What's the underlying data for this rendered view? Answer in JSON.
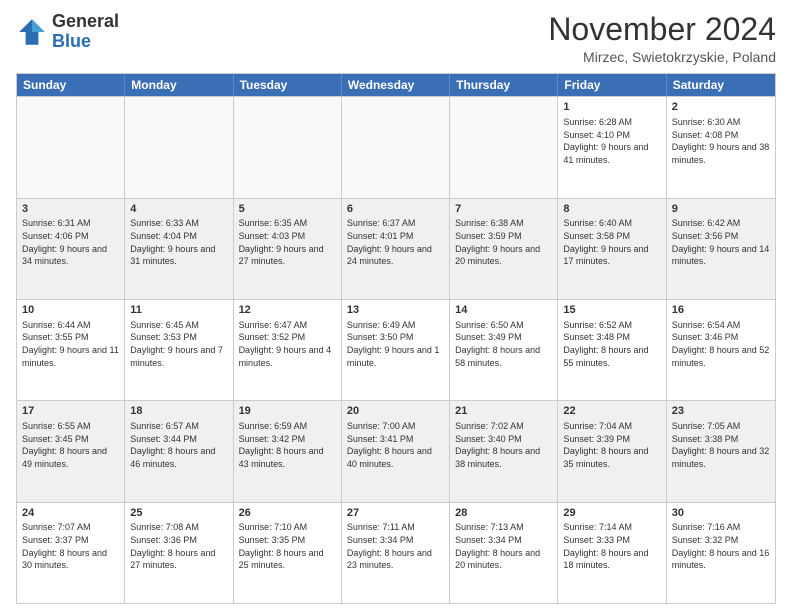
{
  "logo": {
    "general": "General",
    "blue": "Blue"
  },
  "title": "November 2024",
  "subtitle": "Mirzec, Swietokrzyskie, Poland",
  "header_days": [
    "Sunday",
    "Monday",
    "Tuesday",
    "Wednesday",
    "Thursday",
    "Friday",
    "Saturday"
  ],
  "weeks": [
    [
      {
        "day": "",
        "text": ""
      },
      {
        "day": "",
        "text": ""
      },
      {
        "day": "",
        "text": ""
      },
      {
        "day": "",
        "text": ""
      },
      {
        "day": "",
        "text": ""
      },
      {
        "day": "1",
        "text": "Sunrise: 6:28 AM\nSunset: 4:10 PM\nDaylight: 9 hours and 41 minutes."
      },
      {
        "day": "2",
        "text": "Sunrise: 6:30 AM\nSunset: 4:08 PM\nDaylight: 9 hours and 38 minutes."
      }
    ],
    [
      {
        "day": "3",
        "text": "Sunrise: 6:31 AM\nSunset: 4:06 PM\nDaylight: 9 hours and 34 minutes."
      },
      {
        "day": "4",
        "text": "Sunrise: 6:33 AM\nSunset: 4:04 PM\nDaylight: 9 hours and 31 minutes."
      },
      {
        "day": "5",
        "text": "Sunrise: 6:35 AM\nSunset: 4:03 PM\nDaylight: 9 hours and 27 minutes."
      },
      {
        "day": "6",
        "text": "Sunrise: 6:37 AM\nSunset: 4:01 PM\nDaylight: 9 hours and 24 minutes."
      },
      {
        "day": "7",
        "text": "Sunrise: 6:38 AM\nSunset: 3:59 PM\nDaylight: 9 hours and 20 minutes."
      },
      {
        "day": "8",
        "text": "Sunrise: 6:40 AM\nSunset: 3:58 PM\nDaylight: 9 hours and 17 minutes."
      },
      {
        "day": "9",
        "text": "Sunrise: 6:42 AM\nSunset: 3:56 PM\nDaylight: 9 hours and 14 minutes."
      }
    ],
    [
      {
        "day": "10",
        "text": "Sunrise: 6:44 AM\nSunset: 3:55 PM\nDaylight: 9 hours and 11 minutes."
      },
      {
        "day": "11",
        "text": "Sunrise: 6:45 AM\nSunset: 3:53 PM\nDaylight: 9 hours and 7 minutes."
      },
      {
        "day": "12",
        "text": "Sunrise: 6:47 AM\nSunset: 3:52 PM\nDaylight: 9 hours and 4 minutes."
      },
      {
        "day": "13",
        "text": "Sunrise: 6:49 AM\nSunset: 3:50 PM\nDaylight: 9 hours and 1 minute."
      },
      {
        "day": "14",
        "text": "Sunrise: 6:50 AM\nSunset: 3:49 PM\nDaylight: 8 hours and 58 minutes."
      },
      {
        "day": "15",
        "text": "Sunrise: 6:52 AM\nSunset: 3:48 PM\nDaylight: 8 hours and 55 minutes."
      },
      {
        "day": "16",
        "text": "Sunrise: 6:54 AM\nSunset: 3:46 PM\nDaylight: 8 hours and 52 minutes."
      }
    ],
    [
      {
        "day": "17",
        "text": "Sunrise: 6:55 AM\nSunset: 3:45 PM\nDaylight: 8 hours and 49 minutes."
      },
      {
        "day": "18",
        "text": "Sunrise: 6:57 AM\nSunset: 3:44 PM\nDaylight: 8 hours and 46 minutes."
      },
      {
        "day": "19",
        "text": "Sunrise: 6:59 AM\nSunset: 3:42 PM\nDaylight: 8 hours and 43 minutes."
      },
      {
        "day": "20",
        "text": "Sunrise: 7:00 AM\nSunset: 3:41 PM\nDaylight: 8 hours and 40 minutes."
      },
      {
        "day": "21",
        "text": "Sunrise: 7:02 AM\nSunset: 3:40 PM\nDaylight: 8 hours and 38 minutes."
      },
      {
        "day": "22",
        "text": "Sunrise: 7:04 AM\nSunset: 3:39 PM\nDaylight: 8 hours and 35 minutes."
      },
      {
        "day": "23",
        "text": "Sunrise: 7:05 AM\nSunset: 3:38 PM\nDaylight: 8 hours and 32 minutes."
      }
    ],
    [
      {
        "day": "24",
        "text": "Sunrise: 7:07 AM\nSunset: 3:37 PM\nDaylight: 8 hours and 30 minutes."
      },
      {
        "day": "25",
        "text": "Sunrise: 7:08 AM\nSunset: 3:36 PM\nDaylight: 8 hours and 27 minutes."
      },
      {
        "day": "26",
        "text": "Sunrise: 7:10 AM\nSunset: 3:35 PM\nDaylight: 8 hours and 25 minutes."
      },
      {
        "day": "27",
        "text": "Sunrise: 7:11 AM\nSunset: 3:34 PM\nDaylight: 8 hours and 23 minutes."
      },
      {
        "day": "28",
        "text": "Sunrise: 7:13 AM\nSunset: 3:34 PM\nDaylight: 8 hours and 20 minutes."
      },
      {
        "day": "29",
        "text": "Sunrise: 7:14 AM\nSunset: 3:33 PM\nDaylight: 8 hours and 18 minutes."
      },
      {
        "day": "30",
        "text": "Sunrise: 7:16 AM\nSunset: 3:32 PM\nDaylight: 8 hours and 16 minutes."
      }
    ]
  ]
}
